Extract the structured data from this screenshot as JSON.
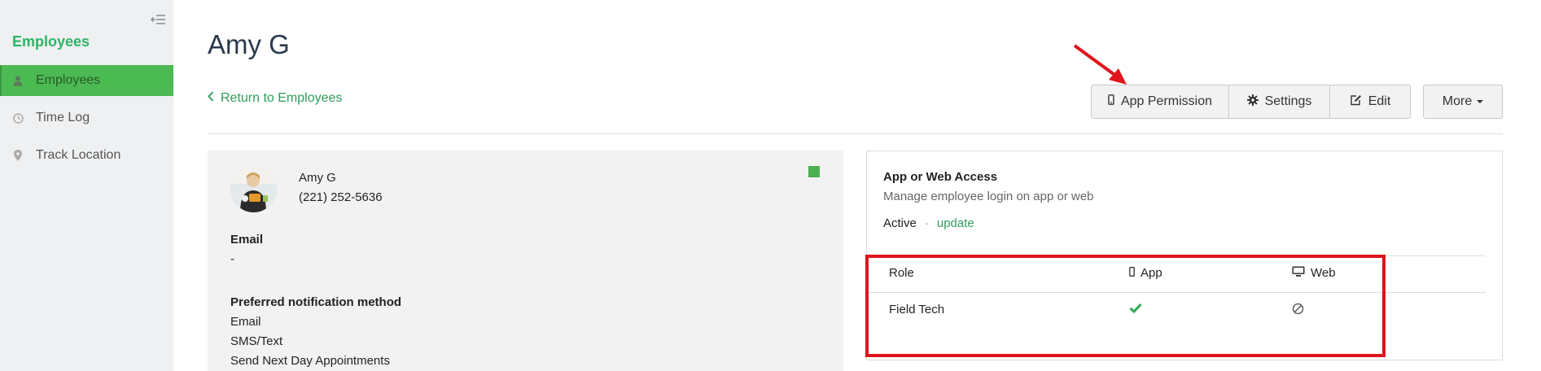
{
  "sidebar": {
    "title": "Employees",
    "items": [
      {
        "label": "Employees",
        "icon": "user-icon",
        "active": true
      },
      {
        "label": "Time Log",
        "icon": "clock-icon",
        "active": false
      },
      {
        "label": "Track Location",
        "icon": "map-pin-icon",
        "active": false
      }
    ]
  },
  "header": {
    "title": "Amy G",
    "back_label": "Return to Employees"
  },
  "toolbar": {
    "app_permission_label": "App Permission",
    "settings_label": "Settings",
    "edit_label": "Edit",
    "more_label": "More"
  },
  "profile": {
    "name": "Amy G",
    "phone": "(221) 252-5636",
    "email_label": "Email",
    "email_value": "-",
    "notification_label": "Preferred notification method",
    "notification_methods": [
      "Email",
      "SMS/Text",
      "Send Next Day Appointments"
    ],
    "status_color": "#4caf50"
  },
  "access": {
    "title": "App or Web Access",
    "subtitle": "Manage employee login on app or web",
    "status": "Active",
    "separator": "·",
    "update_label": "update",
    "table": {
      "headers": {
        "role": "Role",
        "app": "App",
        "web": "Web"
      },
      "rows": [
        {
          "role": "Field Tech",
          "app": "check-icon",
          "web": "blocked-icon"
        }
      ]
    }
  },
  "colors": {
    "accent": "#2db563",
    "active_item": "#4cba52",
    "annotation": "#e0141c"
  }
}
